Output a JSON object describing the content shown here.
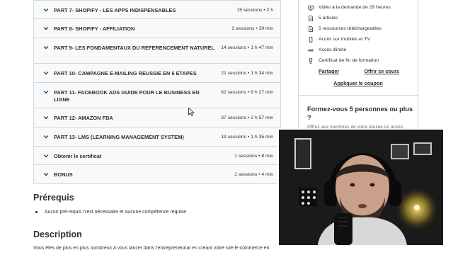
{
  "curriculum": {
    "sections": [
      {
        "title": "PART 7- SHOPIFY - LES APPS INDISPENSABLES",
        "meta": "15 sessions • 2 h"
      },
      {
        "title": "PART 8- SHOPIFY - AFFILIATION",
        "meta": "3 sessions • 39 min"
      },
      {
        "title": "PART 9- LES FONDAMENTAUX DU REFERENCEMENT NATUREL",
        "meta": "14 sessions • 1 h 47 min"
      },
      {
        "title": "PART 10- CAMPAGNE E-MAILING REUSSIE EN 6 ETAPES",
        "meta": "21 sessions • 1 h 34 min"
      },
      {
        "title": "PART 11- FACEBOOK ADS GUIDE POUR LE BUSINESS EN LIGNE",
        "meta": "62 sessions • 9 h 27 min"
      },
      {
        "title": "PART 12- AMAZON FBA",
        "meta": "37 sessions • 2 h 57 min"
      },
      {
        "title": "PART 13- LMS (LEARNING MANAGEMENT SYSTEM)",
        "meta": "19 sessions • 1 h 35 min"
      },
      {
        "title": "Obtenir le certificat",
        "meta": "1 sessions • 8 min"
      },
      {
        "title": "BONUS",
        "meta": "1 sessions • 4 min"
      }
    ]
  },
  "sidebar": {
    "includes": [
      {
        "icon": "video-icon",
        "label": "Vidéo à la demande de 29 heures"
      },
      {
        "icon": "article-icon",
        "label": "5 articles"
      },
      {
        "icon": "download-icon",
        "label": "5 ressources téléchargeables"
      },
      {
        "icon": "mobile-icon",
        "label": "Accès sur mobiles et TV"
      },
      {
        "icon": "infinity-icon",
        "label": "Accès illimité"
      },
      {
        "icon": "trophy-icon",
        "label": "Certificat de fin de formation"
      }
    ],
    "share_label": "Partager",
    "gift_label": "Offrir ce cours",
    "coupon_label": "Appliquer le coupon",
    "team_title": "Formez-vous 5 personnes ou plus ?",
    "team_desc": "Offrez aux membres de votre équipe un accès"
  },
  "requirements": {
    "heading": "Prérequis",
    "items": [
      "Aucun pré-requis n'est nécessaire et aucune compétence requise"
    ]
  },
  "description": {
    "heading": "Description",
    "text": "Vous êtes de plus en plus nombreux à vous lancer dans l'entrepreneuriat en créant votre site E-commerce en"
  },
  "colors": {
    "section_bg": "#f7f9fa",
    "border": "#d1d7dc",
    "text": "#2d2f31"
  }
}
